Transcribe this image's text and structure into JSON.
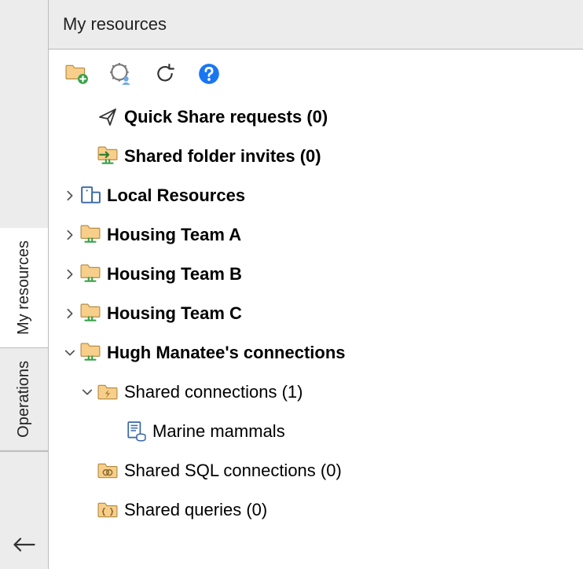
{
  "sidebar": {
    "tabs": [
      {
        "label": "My resources",
        "active": true
      },
      {
        "label": "Operations",
        "active": false
      }
    ]
  },
  "panel": {
    "title": "My resources"
  },
  "toolbar": {
    "new_folder": "New folder",
    "config_users": "Manage users",
    "refresh": "Refresh",
    "help": "Help"
  },
  "tree": {
    "quick_share": {
      "label": "Quick Share requests (0)"
    },
    "shared_invites": {
      "label": "Shared folder invites (0)"
    },
    "local_resources": {
      "label": "Local Resources"
    },
    "team_a": {
      "label": "Housing Team A"
    },
    "team_b": {
      "label": "Housing Team B"
    },
    "team_c": {
      "label": "Housing Team C"
    },
    "hugh": {
      "label": "Hugh Manatee's connections"
    },
    "shared_connections": {
      "label": "Shared connections (1)"
    },
    "marine_mammals": {
      "label": "Marine mammals"
    },
    "shared_sql": {
      "label": "Shared SQL connections (0)"
    },
    "shared_queries": {
      "label": "Shared queries (0)"
    }
  },
  "colors": {
    "folder_fill": "#f7cf8a",
    "folder_stroke": "#b0863c",
    "help_blue": "#1976f2",
    "shared_green": "#3aa24a"
  }
}
